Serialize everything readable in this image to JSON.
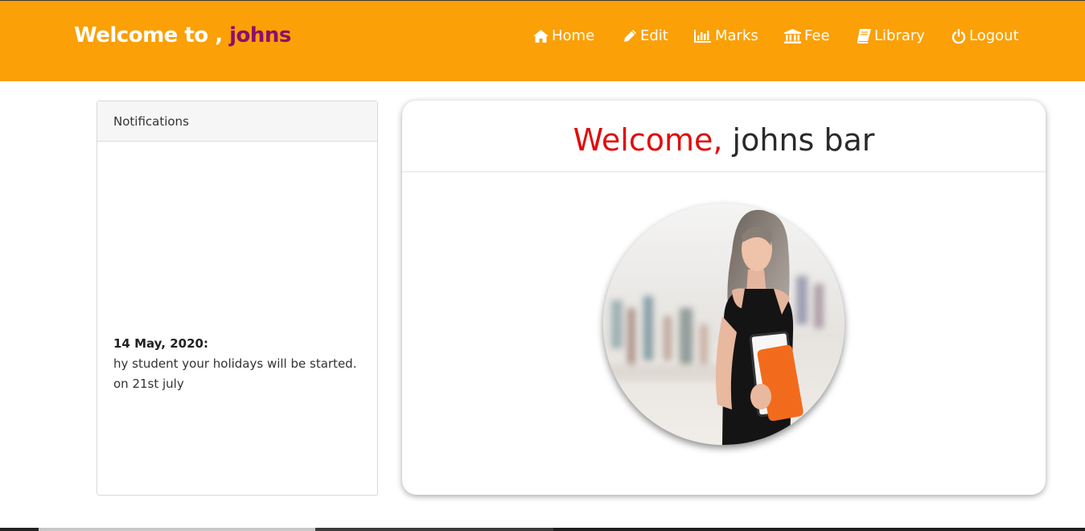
{
  "header": {
    "brand_prefix": "Welcome to , ",
    "brand_user": "johns",
    "bg_color": "#fba006",
    "user_color": "#8a0f6e"
  },
  "nav": {
    "items": [
      {
        "label": "Home",
        "icon": "home-icon"
      },
      {
        "label": "Edit",
        "icon": "pencil-icon"
      },
      {
        "label": "Marks",
        "icon": "bar-chart-icon"
      },
      {
        "label": "Fee",
        "icon": "bank-icon"
      },
      {
        "label": "Library",
        "icon": "book-icon"
      },
      {
        "label": "Logout",
        "icon": "power-icon"
      }
    ]
  },
  "notifications": {
    "title": "Notifications",
    "items": [
      {
        "date": "14 May, 2020:",
        "text": "hy student your holidays will be started. on 21st july"
      }
    ]
  },
  "main": {
    "greeting": "Welcome, ",
    "name": "johns bar",
    "greeting_color": "#e00d0d",
    "avatar": "student-photo"
  }
}
